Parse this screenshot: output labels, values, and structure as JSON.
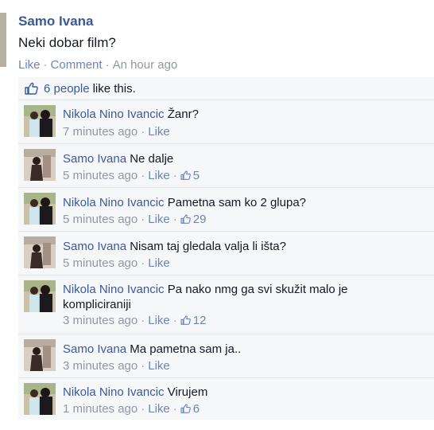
{
  "post": {
    "author": "Samo Ivana",
    "text": "Neki dobar film?",
    "like_label": "Like",
    "comment_label": "Comment",
    "time": "An hour ago"
  },
  "likes": {
    "count_text": "6 people",
    "suffix": "like this."
  },
  "comments": [
    {
      "author": "Nikola Nino Ivancic",
      "text": "Žanr?",
      "time": "7 minutes ago",
      "like_label": "Like",
      "likes": ""
    },
    {
      "author": "Samo Ivana",
      "text": "Ne dalje",
      "time": "5 minutes ago",
      "like_label": "Like",
      "likes": "5"
    },
    {
      "author": "Nikola Nino Ivancic",
      "text": "Pametna sam ko 2 glupa?",
      "time": "5 minutes ago",
      "like_label": "Like",
      "likes": "29"
    },
    {
      "author": "Samo Ivana",
      "text": "Nisam taj gledala valja li išta?",
      "time": "5 minutes ago",
      "like_label": "Like",
      "likes": ""
    },
    {
      "author": "Nikola Nino Ivancic",
      "text": "Pa nako nmg ga svi skužit malo je kompliciraniji",
      "time": "3 minutes ago",
      "like_label": "Like",
      "likes": "12"
    },
    {
      "author": "Samo Ivana",
      "text": "Ma pametna sam ja..",
      "time": "3 minutes ago",
      "like_label": "Like",
      "likes": ""
    },
    {
      "author": "Nikola Nino Ivancic",
      "text": "Virujem",
      "time": "1 minutes ago",
      "like_label": "Like",
      "likes": "6"
    }
  ],
  "colors": {
    "link": "#3b5998",
    "meta": "#9197a3",
    "ufi_bg": "#f6f7f9",
    "border": "#e1e2e3"
  },
  "icons": {
    "like": "thumbs-up-icon"
  }
}
